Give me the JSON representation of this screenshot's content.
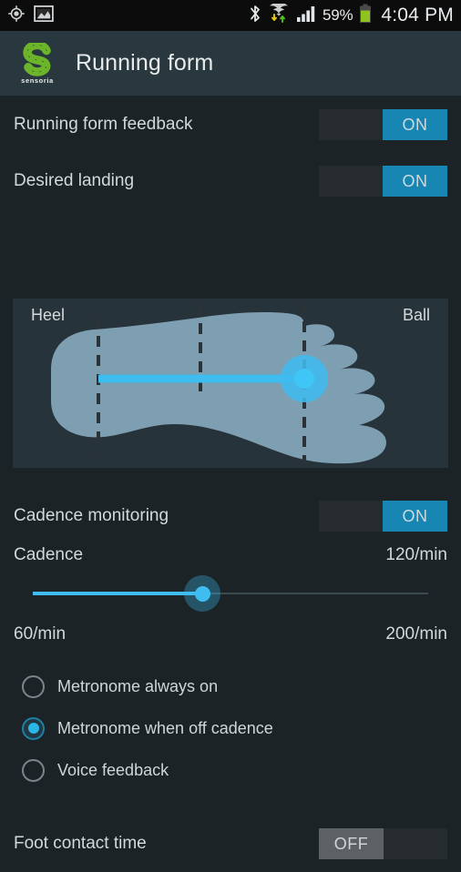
{
  "status_bar": {
    "icons_left": [
      "gps-location-icon",
      "screenshot-image-icon"
    ],
    "icons_right": [
      "bluetooth-icon",
      "wifi-icon",
      "cellular-signal-icon",
      "battery-icon"
    ],
    "battery_percent": "59%",
    "clock": "4:04 PM"
  },
  "action_bar": {
    "logo_letter": "S",
    "logo_subtext": "sensoria",
    "title": "Running form"
  },
  "settings": {
    "running_form_feedback": {
      "label": "Running form feedback",
      "toggle_state": "ON"
    },
    "desired_landing": {
      "label": "Desired landing",
      "toggle_state": "ON"
    },
    "cadence_monitoring": {
      "label": "Cadence monitoring",
      "toggle_state": "ON"
    },
    "foot_contact_time": {
      "label": "Foot contact time",
      "toggle_state": "OFF"
    }
  },
  "landing_diagram": {
    "heel_label": "Heel",
    "ball_label": "Ball",
    "marker_position_percent": 67,
    "zone_marks_percent": [
      20,
      45,
      67
    ],
    "foot_color": "#7e9fb1",
    "panel_color": "#27333a",
    "marker_color": "#3fbdf1"
  },
  "cadence": {
    "label": "Cadence",
    "value_label": "120/min",
    "value": 120,
    "min_label": "60/min",
    "max_label": "200/min",
    "min": 60,
    "max": 200,
    "fill_percent": 42.9,
    "accent_color": "#3fbdf1"
  },
  "feedback_options": {
    "items": [
      {
        "label": "Metronome always on",
        "selected": false
      },
      {
        "label": "Metronome when off cadence",
        "selected": true
      },
      {
        "label": "Voice feedback",
        "selected": false
      }
    ]
  }
}
